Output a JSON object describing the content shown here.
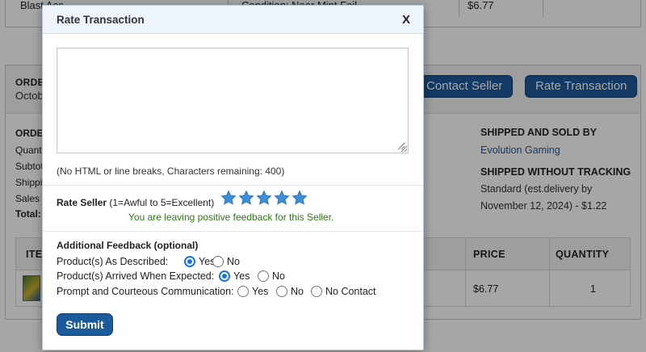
{
  "background": {
    "top_row": {
      "item_text": "Blast Acc",
      "condition_text": "Condition: Near Mint Foil",
      "price_text": "$6.77"
    },
    "order": {
      "label": "ORDE",
      "date": "Octobe",
      "contact_seller_label": "Contact Seller",
      "rate_transaction_label": "Rate Transaction",
      "summary_title": "ORDE",
      "summary_rows": [
        "Quant",
        "Subtot",
        "Shippi",
        "Sales"
      ],
      "summary_total": "Total:",
      "shipped_sold_by_title": "SHIPPED AND SOLD BY",
      "seller_name": "Evolution Gaming",
      "tracking_title": "SHIPPED WITHOUT TRACKING",
      "shipping_line_1": "Standard (est.delivery by",
      "shipping_line_2": "November 12, 2024) - $1.22"
    },
    "items_table": {
      "headers": {
        "item": "ITEM",
        "price": "PRICE",
        "quantity": "QUANTITY"
      },
      "row": {
        "price": "$6.77",
        "quantity": "1"
      }
    }
  },
  "modal": {
    "title": "Rate Transaction",
    "close_label": "X",
    "comment_value": "",
    "hint": "(No HTML or line breaks, Characters remaining: 400)",
    "rate_seller_label": "Rate Seller",
    "rate_seller_scale": "(1=Awful to 5=Excellent)",
    "rating": 5,
    "star_color": "#3a8fd6",
    "positive_message": "You are leaving positive feedback for this Seller.",
    "additional_title": "Additional Feedback (optional)",
    "questions": [
      {
        "label": "Product(s) As Described:",
        "options": [
          "Yes",
          "No"
        ],
        "selected": "Yes"
      },
      {
        "label": "Product(s) Arrived When Expected:",
        "options": [
          "Yes",
          "No"
        ],
        "selected": "Yes"
      },
      {
        "label": "Prompt and Courteous Communication:",
        "options": [
          "Yes",
          "No",
          "No Contact"
        ],
        "selected": ""
      }
    ],
    "submit_label": "Submit"
  },
  "colors": {
    "primary_button": "#1d5a9a",
    "positive_text": "#2a7a12",
    "radio_selected": "#1a73e8"
  }
}
